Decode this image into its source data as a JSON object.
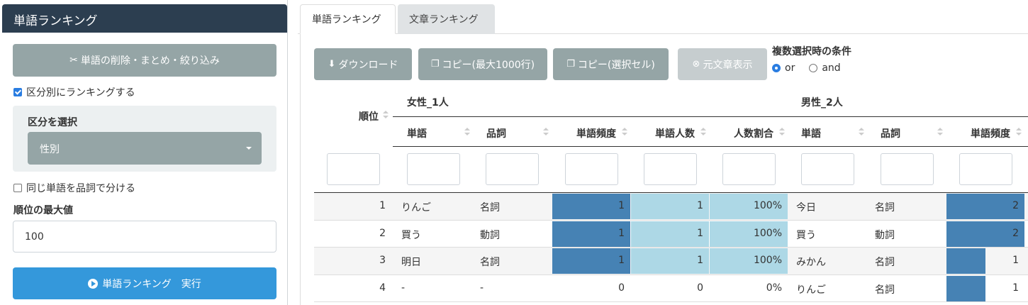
{
  "sidebar": {
    "title": "単語ランキング",
    "filter_button": "単語の削除・まとめ・絞り込み",
    "by_category_label": "区分別にランキングする",
    "by_category_checked": true,
    "category_select_label": "区分を選択",
    "category_select_value": "性別",
    "split_pos_label": "同じ単語を品詞で分ける",
    "split_pos_checked": false,
    "max_rank_label": "順位の最大値",
    "max_rank_value": "100",
    "run_button": "単語ランキング　実行"
  },
  "tabs": [
    {
      "label": "単語ランキング",
      "active": true
    },
    {
      "label": "文章ランキング",
      "active": false
    }
  ],
  "toolbar": {
    "download": "ダウンロード",
    "copy_max": "コピー(最大1000行)",
    "copy_selected": "コピー(選択セル)",
    "show_source": "元文章表示",
    "condition_title": "複数選択時の条件",
    "radio_or": "or",
    "radio_and": "and",
    "selected_condition": "or"
  },
  "table": {
    "rank_header": "順位",
    "group1": "女性_1人",
    "group2": "男性_2人",
    "columns": [
      "単語",
      "品詞",
      "単語頻度",
      "単語人数",
      "人数割合",
      "単語",
      "品詞",
      "単語頻度"
    ],
    "rows": [
      {
        "rank": "1",
        "w1": "りんご",
        "p1": "名詞",
        "f1": "1",
        "n1": "1",
        "r1": "100%",
        "w2": "今日",
        "p2": "名詞",
        "f2": "2",
        "bar_f1": 1.0,
        "bar_n1": 1.0,
        "bar_r1": 1.0,
        "bar_f2": 1.0
      },
      {
        "rank": "2",
        "w1": "買う",
        "p1": "動詞",
        "f1": "1",
        "n1": "1",
        "r1": "100%",
        "w2": "買う",
        "p2": "動詞",
        "f2": "2",
        "bar_f1": 1.0,
        "bar_n1": 1.0,
        "bar_r1": 1.0,
        "bar_f2": 1.0
      },
      {
        "rank": "3",
        "w1": "明日",
        "p1": "名詞",
        "f1": "1",
        "n1": "1",
        "r1": "100%",
        "w2": "みかん",
        "p2": "名詞",
        "f2": "1",
        "bar_f1": 1.0,
        "bar_n1": 1.0,
        "bar_r1": 1.0,
        "bar_f2": 0.5
      },
      {
        "rank": "4",
        "w1": "-",
        "p1": "-",
        "f1": "0",
        "n1": "0",
        "r1": "0%",
        "w2": "りんご",
        "p2": "名詞",
        "f2": "1",
        "bar_f1": 0,
        "bar_n1": 0,
        "bar_r1": 0,
        "bar_f2": 0.5
      }
    ]
  },
  "colors": {
    "header_dark": "#2c3e50",
    "gray_button": "#95a5a6",
    "blue_button": "#3498db",
    "bar_dark": "#4682b4",
    "bar_light": "#add8e6"
  }
}
